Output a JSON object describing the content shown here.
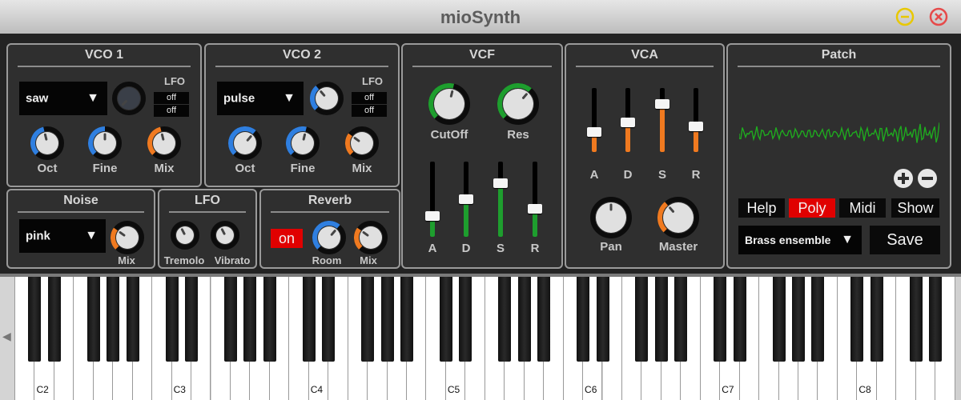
{
  "window": {
    "title": "mioSynth",
    "minimize_color": "#e8c800",
    "close_color": "#e64a4a"
  },
  "vco1": {
    "title": "VCO 1",
    "waveform": "saw",
    "lfo_label": "LFO",
    "lfo1": "off",
    "lfo2": "off",
    "labels": [
      "Oct",
      "Fine",
      "Mix"
    ]
  },
  "vco2": {
    "title": "VCO 2",
    "waveform": "pulse",
    "lfo_label": "LFO",
    "lfo1": "off",
    "lfo2": "off",
    "labels": [
      "Oct",
      "Fine",
      "Mix"
    ]
  },
  "vcf": {
    "title": "VCF",
    "knobs": [
      "CutOff",
      "Res"
    ],
    "faders": [
      "A",
      "D",
      "S",
      "R"
    ]
  },
  "vca": {
    "title": "VCA",
    "faders": [
      "A",
      "D",
      "S",
      "R"
    ],
    "knobs": [
      "Pan",
      "Master"
    ]
  },
  "patch": {
    "title": "Patch",
    "buttons": [
      "Help",
      "Poly",
      "Midi",
      "Show"
    ],
    "active_button": "Poly",
    "preset": "Brass ensemble",
    "save_label": "Save",
    "wave_color": "#1faa1f"
  },
  "noise": {
    "title": "Noise",
    "type": "pink",
    "mix_label": "Mix"
  },
  "lfo": {
    "title": "LFO",
    "labels": [
      "Tremolo",
      "Vibrato"
    ]
  },
  "reverb": {
    "title": "Reverb",
    "toggle": "on",
    "labels": [
      "Room",
      "Mix"
    ]
  },
  "keyboard": {
    "labels": [
      "C2",
      "C3",
      "C4",
      "C5",
      "C6",
      "C7",
      "C8"
    ],
    "scroll_icon": "◀"
  },
  "colors": {
    "blue": "#2f7fe0",
    "orange": "#f07a20",
    "green": "#1e9e2e",
    "red": "#e00000"
  }
}
